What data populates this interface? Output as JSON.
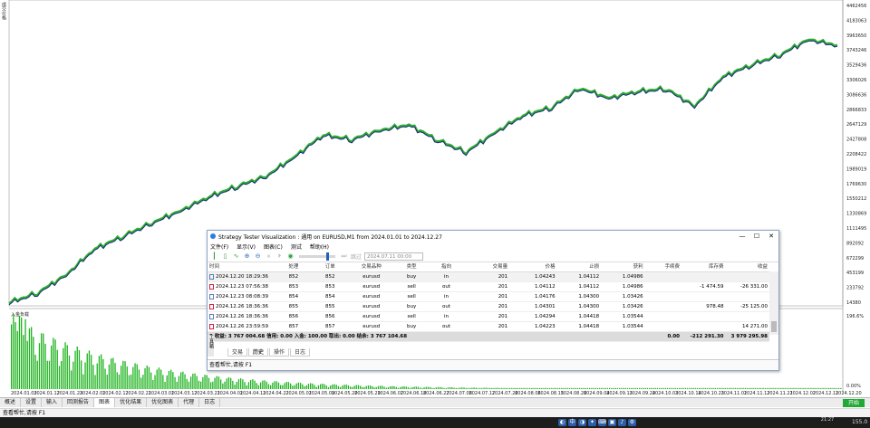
{
  "chart_data": {
    "type": "line",
    "xlabel": "",
    "ylabel": "",
    "y_ticks": [
      "4462456",
      "4183063",
      "3963650",
      "3743246",
      "3529436",
      "3306026",
      "3086636",
      "2866833",
      "2647129",
      "2427808",
      "2208422",
      "1989019",
      "1769630",
      "1550212",
      "1330869",
      "1111495",
      "892092",
      "672299",
      "453199",
      "233792",
      "14380"
    ],
    "x_ticks": [
      "2024.01.03",
      "2024.01.12",
      "2024.01.23",
      "2024.02.01",
      "2024.02.12",
      "2024.02.21",
      "2024.03.01",
      "2024.03.12",
      "2024.03.21",
      "2024.04.01",
      "2024.04.11",
      "2024.04.22",
      "2024.05.01",
      "2024.05.09",
      "2024.05.20",
      "2024.05.29",
      "2024.06.07",
      "2024.06.18",
      "2024.06.27",
      "2024.07.08",
      "2024.07.17",
      "2024.07.26",
      "2024.08.06",
      "2024.08.15",
      "2024.08.26",
      "2024.09.04",
      "2024.09.13",
      "2024.09.24",
      "2024.10.03",
      "2024.10.14",
      "2024.10.23",
      "2024.11.01",
      "2024.11.12",
      "2024.11.21",
      "2024.12.02",
      "2024.12.11",
      "2024.12.20"
    ],
    "series": [
      {
        "values": [
          14380,
          160000,
          430000,
          820000,
          1010000,
          1210000,
          1390000,
          1600000,
          1760000,
          1910000,
          2200000,
          2530000,
          2460000,
          2600000,
          2680000,
          2450000,
          2270000,
          2560000,
          2820000,
          2940000,
          3230000,
          3080000,
          3180000,
          3220000,
          2960000,
          3400000,
          3580000,
          3730000,
          3960000,
          3870000
        ]
      }
    ],
    "y_min": 14380,
    "y_max": 4462456,
    "sub_panel": {
      "label": "入金负载",
      "y_top": "196.6%",
      "y_bottom": "0.00%",
      "histogram_peak": 196.6
    }
  },
  "app": {
    "left_label": "成交价格"
  },
  "tabs": [
    "概述",
    "设置",
    "输入",
    "回测报告",
    "图表",
    "优化结果",
    "优化图表",
    "代理",
    "日志"
  ],
  "active_tab": "图表",
  "start_label": "开始",
  "status_text": "查看帮忙,请按 F1",
  "clock": "21:27",
  "speed": "155.0",
  "window": {
    "title": "Strategy Tester Visualization : 通用 on EURUSD,M1 from 2024.01.01 to 2024.12.27",
    "menu": [
      "文件(F)",
      "显示(V)",
      "图表(C)",
      "测试",
      "帮助(H)"
    ],
    "toolbar_text": "跳过",
    "date_value": "2024.07.11 00:00",
    "columns": [
      "时间",
      "处理",
      "订单",
      "交易品种",
      "类型",
      "指向",
      "交易量",
      "价格",
      "止损",
      "获利",
      "手续费",
      "库存费",
      "收益"
    ],
    "rows": [
      {
        "time": "2024.12.20 18:29:36",
        "deal": "852",
        "order": "852",
        "symbol": "eurusd",
        "type": "buy",
        "dir": "in",
        "vol": "201",
        "price": "1.04243",
        "sl": "1.04112",
        "tp": "1.04986",
        "fee": "",
        "swap": "",
        "profit": ""
      },
      {
        "time": "2024.12.23 07:56:38",
        "deal": "853",
        "order": "853",
        "symbol": "eurusd",
        "type": "sell",
        "dir": "out",
        "vol": "201",
        "price": "1.04112",
        "sl": "1.04112",
        "tp": "1.04986",
        "fee": "",
        "swap": "-1 474.59",
        "profit": "-26 331.00"
      },
      {
        "time": "2024.12.23 08:08:39",
        "deal": "854",
        "order": "854",
        "symbol": "eurusd",
        "type": "sell",
        "dir": "in",
        "vol": "201",
        "price": "1.04176",
        "sl": "1.04300",
        "tp": "1.03426",
        "fee": "",
        "swap": "",
        "profit": ""
      },
      {
        "time": "2024.12.26 18:36:36",
        "deal": "855",
        "order": "855",
        "symbol": "eurusd",
        "type": "buy",
        "dir": "out",
        "vol": "201",
        "price": "1.04301",
        "sl": "1.04300",
        "tp": "1.03426",
        "fee": "",
        "swap": "978.48",
        "profit": "-25 125.00"
      },
      {
        "time": "2024.12.26 18:36:36",
        "deal": "856",
        "order": "856",
        "symbol": "eurusd",
        "type": "sell",
        "dir": "in",
        "vol": "201",
        "price": "1.04294",
        "sl": "1.04418",
        "tp": "1.03544",
        "fee": "",
        "swap": "",
        "profit": ""
      },
      {
        "time": "2024.12.26 23:59:59",
        "deal": "857",
        "order": "857",
        "symbol": "eurusd",
        "type": "buy",
        "dir": "out",
        "vol": "201",
        "price": "1.04223",
        "sl": "1.04418",
        "tp": "1.03544",
        "fee": "",
        "swap": "",
        "profit": "14 271.00"
      }
    ],
    "summary": {
      "text": "0 收益: 3 767 004.68  信用: 0.00  入金: 100.00  取出: 0.00  结余: 3 767 104.68",
      "fee": "0.00",
      "swap": "-212 291.30",
      "profit": "3 979 295.98"
    },
    "tabs": [
      "交易",
      "历史",
      "操作",
      "日志"
    ],
    "active_tab": "历史",
    "status": "查看帮忙,请按 F1",
    "side_label": "工具箱"
  }
}
